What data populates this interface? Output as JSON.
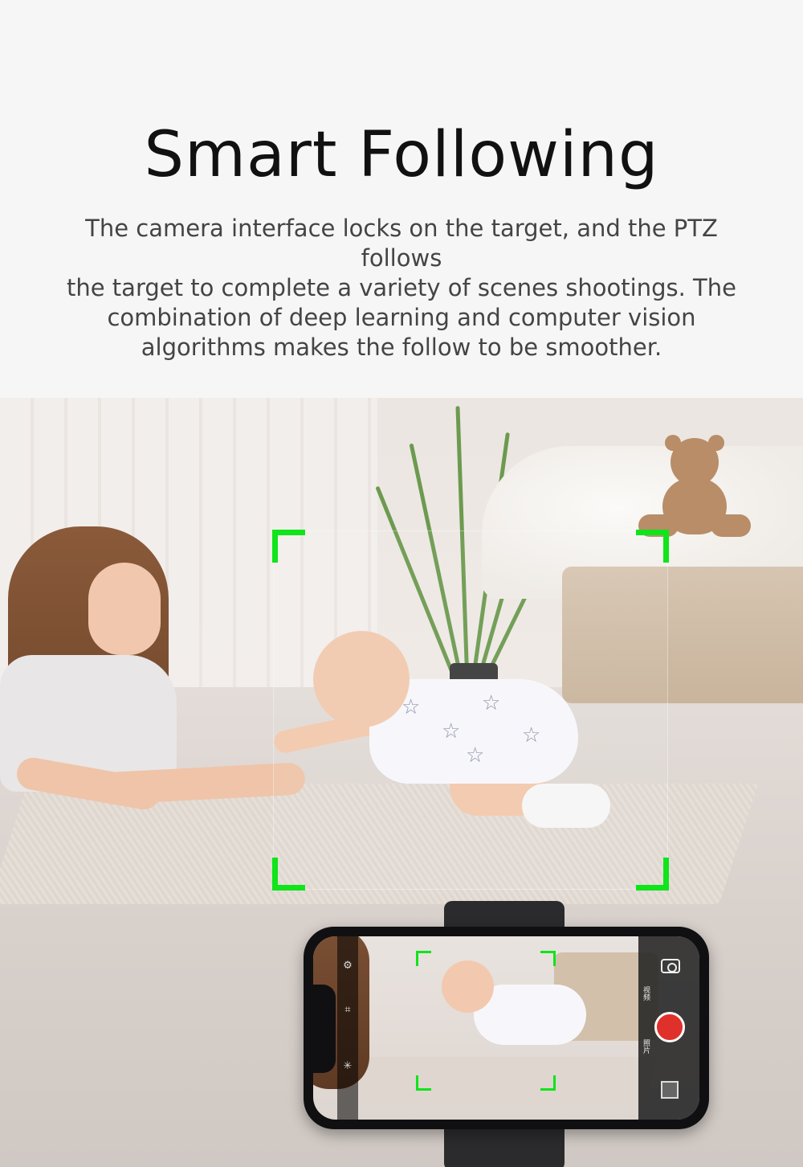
{
  "heading": {
    "title": "Smart Following"
  },
  "description": {
    "lines": [
      "The camera interface locks on the target, and the PTZ follows",
      "the target to complete a variety of scenes shootings. The",
      "combination of deep learning and computer vision",
      "algorithms makes the follow to be smoother."
    ]
  },
  "colors": {
    "tracking_frame": "#10e41b",
    "record_button": "#e0302b",
    "background": "#f6f6f6"
  },
  "phone_ui": {
    "side_labels": [
      "视频",
      "照片"
    ],
    "icons": [
      "settings-icon",
      "focus-icon",
      "bluetooth-icon",
      "switch-camera-icon",
      "record-icon",
      "gallery-thumbnail-icon"
    ]
  }
}
